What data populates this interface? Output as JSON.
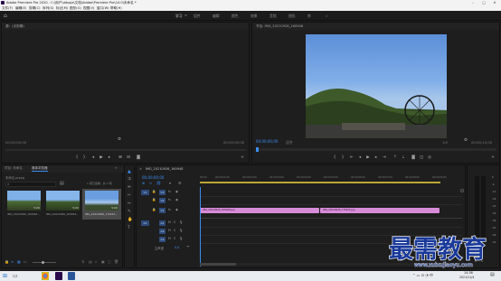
{
  "window": {
    "app_icon": "premiere-pro-icon",
    "title": "Adobe Premiere Pro 2020 - C:\\用户\\ddsoja\\文档\\Adobe\\Premiere Pro\\14.0\\未命名 *"
  },
  "menu": [
    "文件(F)",
    "编辑(E)",
    "剪辑(C)",
    "序列(S)",
    "标记(M)",
    "图形(G)",
    "视图(V)",
    "窗口(W)",
    "帮助(H)"
  ],
  "workspaces": [
    "学习",
    "组件",
    "编辑",
    "颜色",
    "效果",
    "音频",
    "图形",
    "库"
  ],
  "source_panel": {
    "title": "源：(无剪辑)",
    "tc_left": "00;00;00;00",
    "tc_right": "00;00;00;00"
  },
  "program_panel": {
    "title": "节目: IMG_20210926_160948",
    "tc_left": "00;00;00;00",
    "fit": "适合",
    "quality": "1/2",
    "tc_right": "00;00;10;00"
  },
  "project_panel": {
    "tabs": [
      "项目: 未命名",
      "媒体浏览器"
    ],
    "project_file": "未命名.prproj",
    "selection": "1 项已选择，共 3 项",
    "thumbnails": [
      "IMG_20210926_160948...",
      "IMG_20210926_160949...",
      "IMG_20210926_170432..."
    ],
    "durations": [
      "5;00",
      "5;00",
      "5;00"
    ]
  },
  "timeline_panel": {
    "tab": "IMG_20210926_160948",
    "timecode": "00;00;00;00",
    "ruler": [
      "00;00",
      "00;00;01;00",
      "00;00;02;00",
      "00;00;03;00",
      "00;00;04;00",
      "00;00;05;00",
      "00;00;06;00",
      "00;00;07;00",
      "00;00;08;00",
      "00;00;09;00"
    ],
    "video_tracks": [
      "V3",
      "V2",
      "V1"
    ],
    "audio_tracks": [
      "A1",
      "A2",
      "A3"
    ],
    "master": "主声道",
    "master_value": "0.0",
    "clips": [
      "IMG_20210926_160948.jpg",
      "IMG_20210926_170432.jpg"
    ]
  },
  "audio_meter": {
    "scale": [
      "0",
      "-6",
      "-12",
      "-18",
      "-24",
      "-30",
      "-36",
      "-42",
      "-48",
      "-54"
    ],
    "labels": [
      "S",
      "S"
    ]
  },
  "watermark": {
    "text": "最需教育",
    "url": "www.zuixujiaoyu.com"
  },
  "taskbar": {
    "time": "14:36",
    "date": "2021/11/4"
  }
}
